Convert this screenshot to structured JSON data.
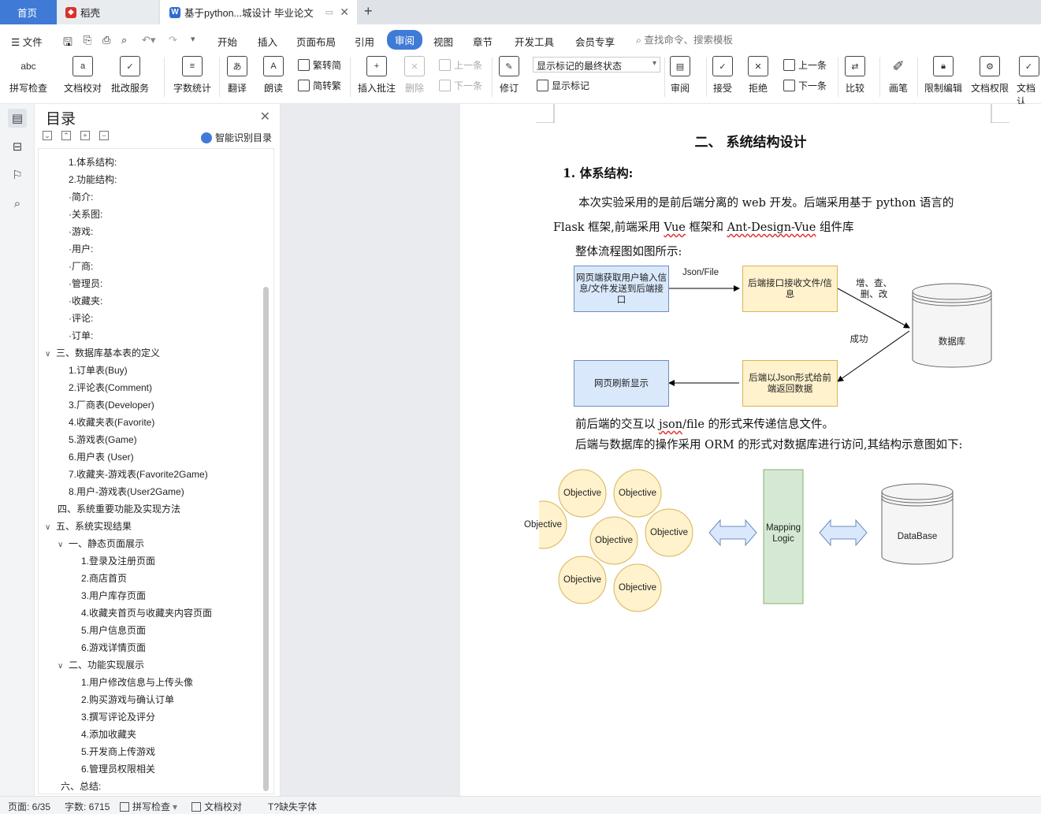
{
  "tabs": {
    "home": "首页",
    "daoke": "稻壳",
    "doc": "基于python...城设计 毕业论文"
  },
  "menu": {
    "file": "文件",
    "items": [
      "开始",
      "插入",
      "页面布局",
      "引用",
      "审阅",
      "视图",
      "章节",
      "开发工具",
      "会员专享"
    ],
    "active": "审阅",
    "search": "查找命令、搜索模板"
  },
  "ribbon": {
    "spell": "拼写检查",
    "doc_check": "文档校对",
    "revise_service": "批改服务",
    "word_count": "字数统计",
    "translate": "翻译",
    "read_aloud": "朗读",
    "to_trad": "繁转简",
    "to_simp": "简转繁",
    "insert_comment": "插入批注",
    "delete": "删除",
    "prev": "上一条",
    "next": "下一条",
    "track": "修订",
    "markup_select": "显示标记的最终状态",
    "show_markup": "显示标记",
    "review": "审阅",
    "accept": "接受",
    "reject": "拒绝",
    "prev2": "上一条",
    "next2": "下一条",
    "compare": "比较",
    "pen": "画笔",
    "restrict_edit": "限制编辑",
    "doc_perm": "文档权限",
    "doc_more": "文档认"
  },
  "nav": {
    "title": "目录",
    "ai_toc": "智能识别目录",
    "toc": [
      {
        "label": "1.体系结构:"
      },
      {
        "label": "2.功能结构:"
      },
      {
        "label": "·简介:"
      },
      {
        "label": "·关系图:"
      },
      {
        "label": "·游戏:"
      },
      {
        "label": "·用户:"
      },
      {
        "label": "·厂商:"
      },
      {
        "label": "·管理员:"
      },
      {
        "label": "·收藏夹:"
      },
      {
        "label": "·评论:"
      },
      {
        "label": "·订单:"
      },
      {
        "label": "三、数据库基本表的定义"
      },
      {
        "label": "1.订单表(Buy)"
      },
      {
        "label": "2.评论表(Comment)"
      },
      {
        "label": "3.厂商表(Developer)"
      },
      {
        "label": "4.收藏夹表(Favorite)"
      },
      {
        "label": "5.游戏表(Game)"
      },
      {
        "label": "6.用户表 (User)"
      },
      {
        "label": "7.收藏夹-游戏表(Favorite2Game)"
      },
      {
        "label": "8.用户-游戏表(User2Game)"
      },
      {
        "label": "四、系统重要功能及实现方法"
      },
      {
        "label": "五、系统实现结果"
      },
      {
        "label": "一、静态页面展示"
      },
      {
        "label": "1.登录及注册页面"
      },
      {
        "label": "2.商店首页"
      },
      {
        "label": "3.用户库存页面"
      },
      {
        "label": "4.收藏夹首页与收藏夹内容页面"
      },
      {
        "label": "5.用户信息页面"
      },
      {
        "label": "6.游戏详情页面"
      },
      {
        "label": "二、功能实现展示"
      },
      {
        "label": "1.用户修改信息与上传头像"
      },
      {
        "label": "2.购买游戏与确认订单"
      },
      {
        "label": "3.撰写评论及评分"
      },
      {
        "label": "4.添加收藏夹"
      },
      {
        "label": "5.开发商上传游戏"
      },
      {
        "label": "6.管理员权限相关"
      },
      {
        "label": "六、总结:"
      }
    ]
  },
  "doc": {
    "heading": "二、 系统结构设计",
    "subheading": "1.  体系结构:",
    "p1_line1": "本次实验采用的是前后端分离的 web 开发。后端采用基于 python 语言的",
    "p1_line2_a": "Flask 框架,前端采用 ",
    "p1_line2_vue": "Vue",
    "p1_line2_b": " 框架和 ",
    "p1_line2_antd": "Ant-Design-Vue",
    "p1_line2_c": " 组件库",
    "p2": "整体流程图如图所示:",
    "flow": {
      "n1": "网页端获取用户输入信息/文件发送到后端接口",
      "n2": "后端接口接收文件/信息",
      "n3": "数据库",
      "n4": "后端以Json形式给前端返回数据",
      "n5": "网页刷新显示",
      "e1": "Json/File",
      "e2": "增、查、删、改",
      "e3": "成功"
    },
    "p3_a": "前后端的交互以 ",
    "p3_json": "json",
    "p3_b": "/file 的形式来传递信息文件。",
    "p4": "后端与数据库的操作采用 ORM 的形式对数据库进行访问,其结构示意图如下:",
    "orm": {
      "obj": "Objective",
      "mapping": "Mapping Logic",
      "db": "DataBase"
    }
  },
  "status": {
    "page": "页面: 6/35",
    "words": "字数: 6715",
    "spell": "拼写检查",
    "proof": "文档校对",
    "missing_font": "缺失字体"
  },
  "colors": {
    "accent": "#3f7bd6",
    "flow_blue": "#dae8fc",
    "flow_yellow": "#fff2cc",
    "flow_green": "#d5e8d4"
  }
}
